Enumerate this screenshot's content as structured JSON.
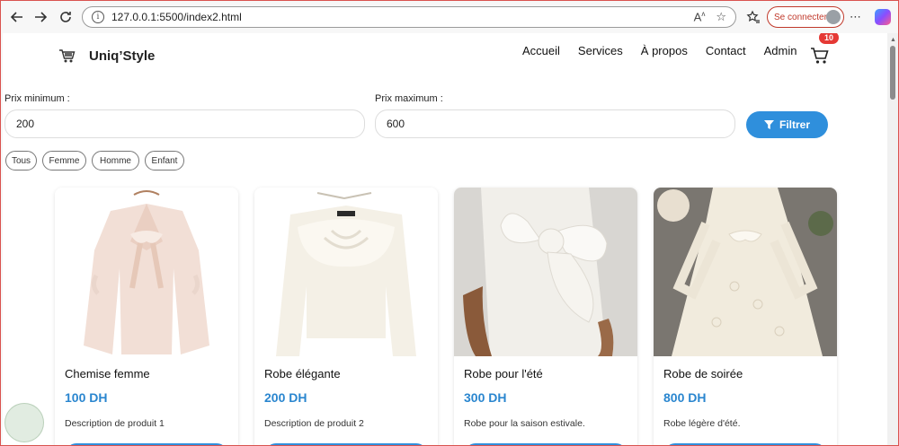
{
  "browser": {
    "url": "127.0.0.1:5500/index2.html",
    "signin_label": "Se connecter"
  },
  "site": {
    "brand": "Uniq’Style",
    "nav": [
      "Accueil",
      "Services",
      "À propos",
      "Contact",
      "Admin"
    ],
    "cart_count": "10"
  },
  "filters": {
    "min_label": "Prix minimum :",
    "min_value": "200",
    "max_label": "Prix maximum :",
    "max_value": "600",
    "button_label": "Filtrer",
    "chips": [
      "Tous",
      "Femme",
      "Homme",
      "Enfant"
    ]
  },
  "products": [
    {
      "title": "Chemise femme",
      "price": "100 DH",
      "desc": "Description de produit 1"
    },
    {
      "title": "Robe élégante",
      "price": "200 DH",
      "desc": "Description de produit 2"
    },
    {
      "title": "Robe pour l'été",
      "price": "300 DH",
      "desc": "Robe pour la saison estivale."
    },
    {
      "title": "Robe de soirée",
      "price": "800 DH",
      "desc": "Robe légère d'été."
    }
  ],
  "colors": {
    "accent": "#2f8fdc",
    "price": "#2a86cf",
    "badge": "#e53935"
  }
}
